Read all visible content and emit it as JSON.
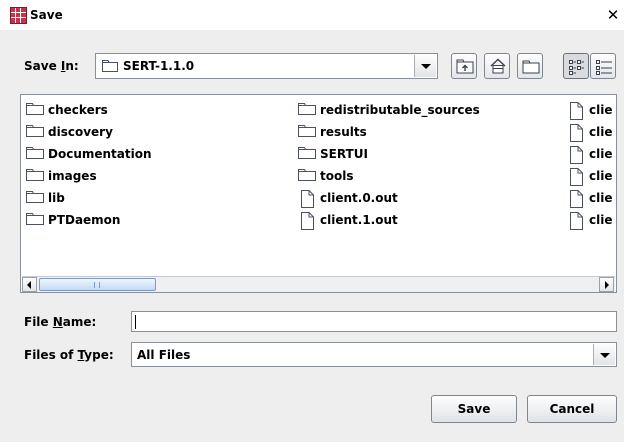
{
  "window": {
    "title": "Save",
    "close_glyph": "✕"
  },
  "save_in": {
    "label_pre": "Save ",
    "label_mnemonic": "I",
    "label_post": "n:",
    "selected": "SERT-1.1.0"
  },
  "toolbar": {
    "buttons": [
      "up-one-level",
      "home",
      "create-new-folder",
      "list-view",
      "details-view"
    ],
    "pressed": "list-view"
  },
  "files": {
    "columns": [
      [
        {
          "name": "checkers",
          "type": "folder"
        },
        {
          "name": "discovery",
          "type": "folder"
        },
        {
          "name": "Documentation",
          "type": "folder"
        },
        {
          "name": "images",
          "type": "folder"
        },
        {
          "name": "lib",
          "type": "folder"
        },
        {
          "name": "PTDaemon",
          "type": "folder"
        }
      ],
      [
        {
          "name": "redistributable_sources",
          "type": "folder"
        },
        {
          "name": "results",
          "type": "folder"
        },
        {
          "name": "SERTUI",
          "type": "folder"
        },
        {
          "name": "tools",
          "type": "folder"
        },
        {
          "name": "client.0.out",
          "type": "file"
        },
        {
          "name": "client.1.out",
          "type": "file"
        }
      ],
      [
        {
          "name": "clie",
          "type": "file"
        },
        {
          "name": "clie",
          "type": "file"
        },
        {
          "name": "clie",
          "type": "file"
        },
        {
          "name": "clie",
          "type": "file"
        },
        {
          "name": "clie",
          "type": "file"
        },
        {
          "name": "clie",
          "type": "file"
        }
      ]
    ]
  },
  "file_name": {
    "label_pre": "File ",
    "label_mnemonic": "N",
    "label_post": "ame:",
    "value": ""
  },
  "files_of_type": {
    "label_pre": "Files of ",
    "label_mnemonic": "T",
    "label_post": "ype:",
    "selected": "All Files"
  },
  "buttons": {
    "save": "Save",
    "cancel": "Cancel"
  },
  "colors": {
    "background": "#eeeeee",
    "list_background": "#ffffff",
    "border": "#8a9098",
    "scroll_thumb": "#c6d9f2"
  }
}
